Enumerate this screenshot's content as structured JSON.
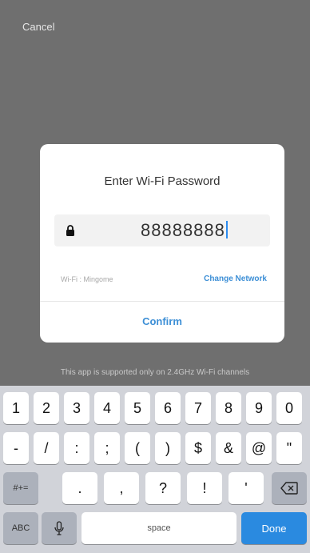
{
  "header": {
    "cancel_label": "Cancel"
  },
  "dialog": {
    "title": "Enter Wi-Fi Password",
    "password_value": "88888888",
    "wifi_label": "Wi-Fi : Mingome",
    "change_network_label": "Change Network",
    "confirm_label": "Confirm"
  },
  "support_note": "This app is supported only on 2.4GHz Wi-Fi channels",
  "keyboard": {
    "row1": [
      "1",
      "2",
      "3",
      "4",
      "5",
      "6",
      "7",
      "8",
      "9",
      "0"
    ],
    "row2": [
      "-",
      "/",
      ":",
      ";",
      "(",
      ")",
      "$",
      "&",
      "@",
      "\""
    ],
    "switch_symbols_label": "#+=",
    "row3": [
      ".",
      ",",
      "?",
      "!",
      "'"
    ],
    "abc_label": "ABC",
    "space_label": "space",
    "done_label": "Done"
  },
  "colors": {
    "accent": "#3d8fd6",
    "done_key": "#2a8ae0",
    "overlay": "#6f6f6f"
  }
}
